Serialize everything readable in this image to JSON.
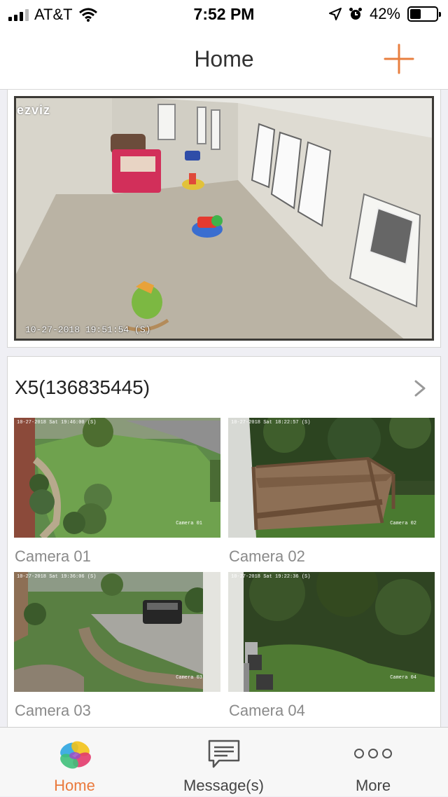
{
  "status_bar": {
    "carrier": "AT&T",
    "time": "7:52 PM",
    "battery": "42%",
    "battery_level": 0.42,
    "icons": [
      "signal-icon",
      "wifi-icon",
      "location-icon",
      "alarm-icon",
      "battery-icon"
    ]
  },
  "nav": {
    "title": "Home",
    "add_icon": "plus-icon",
    "accent": "#e87f3f"
  },
  "featured_camera": {
    "brand": "ezviz",
    "timestamp": "10-27-2018 19:51:54 (S)"
  },
  "device_group": {
    "name": "X5(136835445)",
    "chevron_icon": "chevron-right-icon",
    "cameras": [
      {
        "label": "Camera 01",
        "stamp": "10-27-2018 Sat 19:46:00 (S)",
        "tag": "Camera 01"
      },
      {
        "label": "Camera 02",
        "stamp": "10-27-2018 Sat 18:22:57 (S)",
        "tag": "Camera 02"
      },
      {
        "label": "Camera 03",
        "stamp": "10-27-2018 Sat 19:36:06 (S)",
        "tag": "Camera 03"
      },
      {
        "label": "Camera 04",
        "stamp": "10-27-2018 Sat 19:22:36 (S)",
        "tag": "Camera 04"
      }
    ]
  },
  "tab_bar": {
    "tabs": [
      {
        "label": "Home",
        "icon": "ezviz-logo-icon",
        "active": true
      },
      {
        "label": "Message(s)",
        "icon": "message-icon",
        "active": false
      },
      {
        "label": "More",
        "icon": "more-icon",
        "active": false
      }
    ],
    "active_color": "#ea7a3d"
  }
}
